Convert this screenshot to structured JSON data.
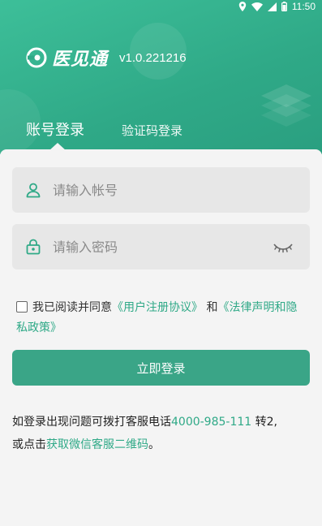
{
  "status": {
    "time": "11:50"
  },
  "brand": {
    "name": "医见通",
    "version": "v1.0.221216"
  },
  "tabs": {
    "account": "账号登录",
    "sms": "验证码登录"
  },
  "form": {
    "account_placeholder": "请输入帐号",
    "password_placeholder": "请输入密码"
  },
  "agreement": {
    "prefix": "我已阅读并同意",
    "user_agreement": "《用户注册协议》",
    "and": " 和",
    "legal_privacy": "《法律声明和隐私政策》"
  },
  "login_button": "立即登录",
  "help": {
    "text1": "如登录出现问题可拨打客服电话",
    "phone": "4000-985-111",
    "text2": " 转2,",
    "text3": "或点击",
    "wechat_link": "获取微信客服二维码",
    "text4": "。"
  },
  "colors": {
    "brand": "#2fa987",
    "button": "#3aa587"
  }
}
